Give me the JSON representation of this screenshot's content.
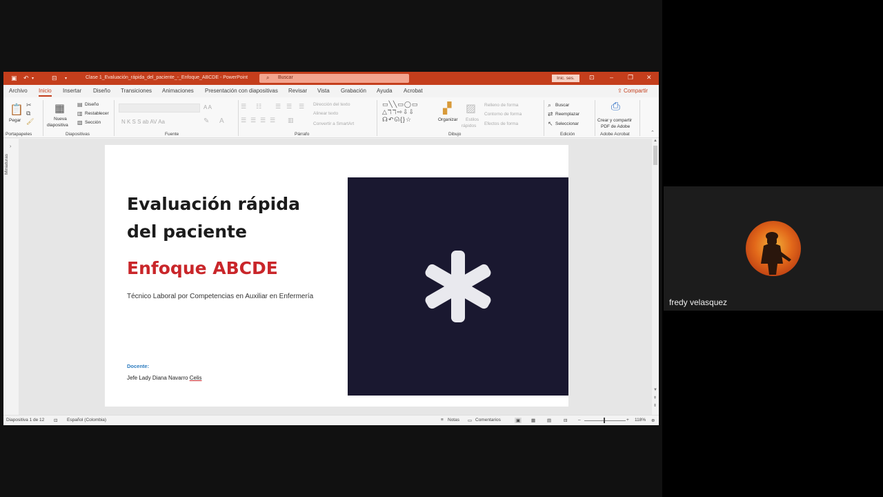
{
  "window": {
    "doc_title": "Clase 1_Evaluación_rápida_del_paciente_-_Enfoque_ABCDE  -  PowerPoint",
    "search_placeholder": "Buscar",
    "signin_label": "Inic. ses."
  },
  "tabs": [
    "Archivo",
    "Inicio",
    "Insertar",
    "Diseño",
    "Transiciones",
    "Animaciones",
    "Presentación con diapositivas",
    "Revisar",
    "Vista",
    "Grabación",
    "Ayuda",
    "Acrobat"
  ],
  "share_label": "Compartir",
  "ribbon": {
    "groups": {
      "portapapeles": "Portapapeles",
      "diapositivas": "Diapositivas",
      "fuente": "Fuente",
      "parrafo": "Párrafo",
      "dibujo": "Dibujo",
      "edicion": "Edición",
      "adobe": "Adobe Acrobat"
    },
    "pegar": "Pegar",
    "nueva_diapositiva": "Nueva",
    "nueva_diapositiva_2": "diapositiva",
    "diseno": "Diseño",
    "restablecer": "Restablecer",
    "seccion": "Sección",
    "direccion_texto": "Dirección del texto",
    "alinear_texto": "Alinear texto",
    "convertir_smartart": "Convertir a SmartArt",
    "organizar": "Organizar",
    "estilos_rapidos": "Estilos",
    "estilos_rapidos_2": "rápidos",
    "relleno_forma": "Relleno de forma",
    "contorno_forma": "Contorno de forma",
    "efectos_forma": "Efectos de forma",
    "buscar": "Buscar",
    "reemplazar": "Reemplazar",
    "seleccionar": "Seleccionar",
    "crear_pdf_1": "Crear y compartir",
    "crear_pdf_2": "PDF de Adobe",
    "font_buttons": "N  K  S  S  ab  AV    Aa",
    "font_size_buttons": "A  A"
  },
  "thumbnails_label": "Miniaturas",
  "slide": {
    "title": "Evaluación rápida del paciente",
    "subtitle": "Enfoque ABCDE",
    "program": "Técnico Laboral por Competencias en Auxiliar en Enfermería",
    "docente_label": "Docente:",
    "docente_name_prefix": "Jefe Lady Diana Navarro ",
    "docente_name_last": "Celis"
  },
  "status": {
    "slide_count": "Diapositiva 1 de 12",
    "language": "Español (Colombia)",
    "notas": "Notas",
    "comentarios": "Comentarios",
    "zoom": "118%"
  },
  "participant": {
    "name": "fredy velasquez"
  },
  "colors": {
    "accent": "#c43e1c",
    "subtitle_red": "#c9262a",
    "image_bg": "#1a1830"
  }
}
